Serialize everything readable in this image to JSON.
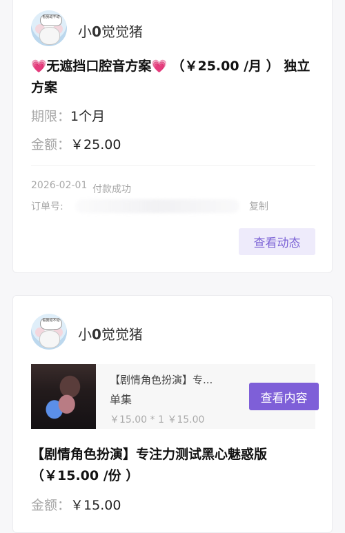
{
  "order1": {
    "username_prefix": "小",
    "username_bold": "0",
    "username_suffix": "觉觉猪",
    "avatar_bubble": "看我动不动",
    "heart_left": "💗",
    "title_main": "无遮挡口腔音方案",
    "heart_right": "💗",
    "title_rest": " （￥25.00 /月 ） 独立方案",
    "period_label": "期限：",
    "period_value": "1个月",
    "amount_label": "金额：",
    "amount_value": "￥25.00",
    "date": "2026-02-01",
    "status": "付款成功",
    "order_no_label": "订单号:",
    "copy_label": "复制",
    "view_button": "查看动态"
  },
  "order2": {
    "username_prefix": "小",
    "username_bold": "0",
    "username_suffix": "觉觉猪",
    "avatar_bubble": "看我动不动",
    "product_title": "【剧情角色扮演】专...",
    "product_type": "单集",
    "product_price": "￥15.00 * 1  ￥15.00",
    "view_button": "查看内容",
    "title": "【剧情角色扮演】专注力测试黑心魅惑版（￥15.00 /份 ）",
    "amount_label": "金额：",
    "amount_value": "￥15.00"
  },
  "colors": {
    "accent": "#7e5fd8",
    "accent_light": "#eeebfb",
    "heart": "#e86bb2",
    "muted": "#a6a6a6"
  }
}
